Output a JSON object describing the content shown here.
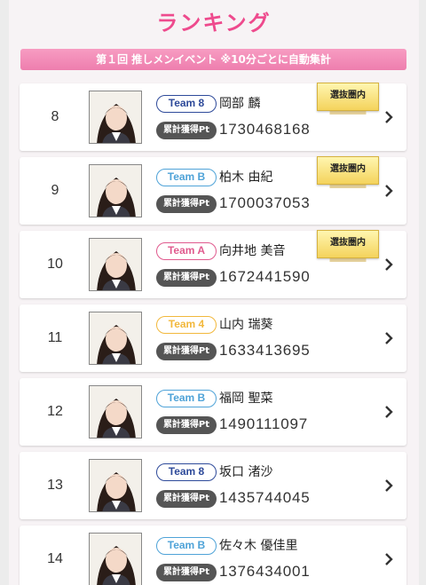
{
  "header": {
    "title": "ランキング",
    "event_banner": "第１回 推しメンイベント ※10分ごとに自動集計"
  },
  "labels": {
    "pt_label": "累計獲得Pt",
    "senbatsu": "選抜圏内"
  },
  "team_colors": {
    "Team 8": "#2e4a9a",
    "Team B": "#4fa3d8",
    "Team A": "#e05a8e",
    "Team 4": "#f2b83c"
  },
  "ranking": [
    {
      "rank": "8",
      "team": "Team 8",
      "name": "岡部 麟",
      "points": "1730468168",
      "senbatsu": true
    },
    {
      "rank": "9",
      "team": "Team B",
      "name": "柏木 由紀",
      "points": "1700037053",
      "senbatsu": true
    },
    {
      "rank": "10",
      "team": "Team A",
      "name": "向井地 美音",
      "points": "1672441590",
      "senbatsu": true
    },
    {
      "rank": "11",
      "team": "Team 4",
      "name": "山内 瑞葵",
      "points": "1633413695",
      "senbatsu": false
    },
    {
      "rank": "12",
      "team": "Team B",
      "name": "福岡 聖菜",
      "points": "1490111097",
      "senbatsu": false
    },
    {
      "rank": "13",
      "team": "Team 8",
      "name": "坂口 渚沙",
      "points": "1435744045",
      "senbatsu": false
    },
    {
      "rank": "14",
      "team": "Team B",
      "name": "佐々木 優佳里",
      "points": "1376434001",
      "senbatsu": false
    }
  ]
}
